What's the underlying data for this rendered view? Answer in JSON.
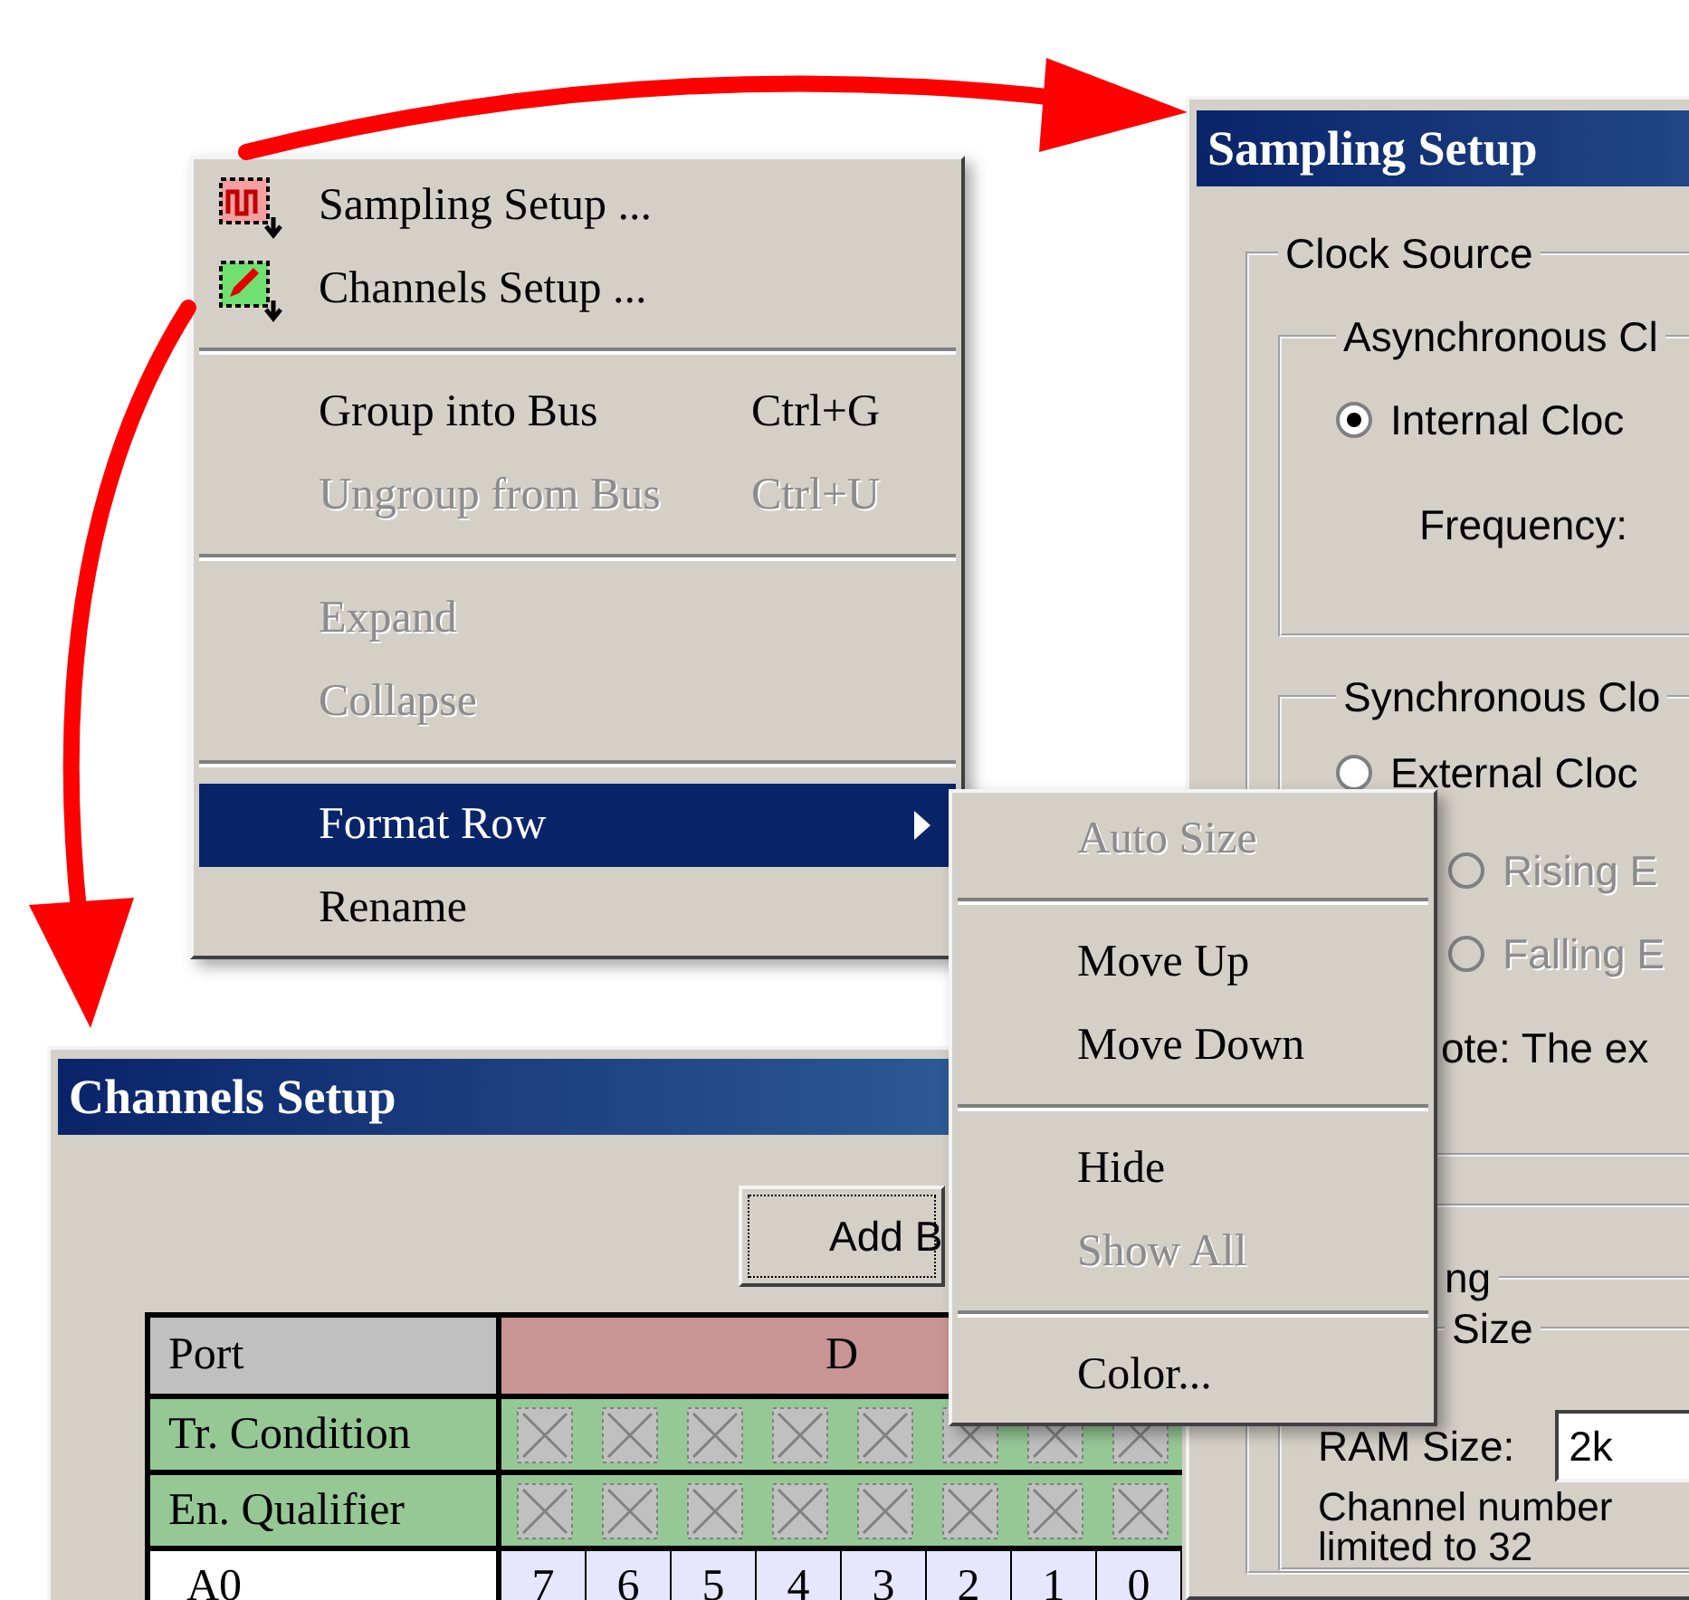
{
  "context_menu": {
    "groups": [
      [
        {
          "kind": "waveform",
          "label": "Sampling Setup ...",
          "disabled": false,
          "selected": false,
          "has_submenu": false
        },
        {
          "kind": "channels",
          "label": "Channels Setup ...",
          "disabled": false,
          "selected": false,
          "has_submenu": false
        }
      ],
      [
        {
          "kind": "plain",
          "label": "Group into Bus",
          "shortcut": "Ctrl+G",
          "disabled": false,
          "selected": false,
          "has_submenu": false
        },
        {
          "kind": "plain",
          "label": "Ungroup from Bus",
          "shortcut": "Ctrl+U",
          "disabled": true,
          "selected": false,
          "has_submenu": false
        }
      ],
      [
        {
          "kind": "plain",
          "label": "Expand",
          "disabled": true,
          "selected": false,
          "has_submenu": false
        },
        {
          "kind": "plain",
          "label": "Collapse",
          "disabled": true,
          "selected": false,
          "has_submenu": false
        }
      ],
      [
        {
          "kind": "plain",
          "label": "Format Row",
          "disabled": false,
          "selected": true,
          "has_submenu": true
        },
        {
          "kind": "plain",
          "label": "Rename",
          "disabled": false,
          "selected": false,
          "has_submenu": false
        }
      ]
    ]
  },
  "submenu": {
    "groups": [
      [
        {
          "label": "Auto Size",
          "disabled": true,
          "selected": false,
          "has_submenu": false
        }
      ],
      [
        {
          "label": "Move Up",
          "disabled": false,
          "selected": false,
          "has_submenu": false
        },
        {
          "label": "Move Down",
          "disabled": false,
          "selected": false,
          "has_submenu": false
        }
      ],
      [
        {
          "label": "Hide",
          "disabled": false,
          "selected": false,
          "has_submenu": false
        },
        {
          "label": "Show All",
          "disabled": true,
          "selected": false,
          "has_submenu": false
        }
      ],
      [
        {
          "label": "Color...",
          "disabled": false,
          "selected": false,
          "has_submenu": false
        }
      ]
    ]
  },
  "sampling_setup": {
    "title": "Sampling Setup",
    "clock_source": {
      "legend": "Clock Source",
      "async": {
        "legend": "Asynchronous Cl",
        "radio": {
          "label": "Internal Cloc",
          "selected": true,
          "disabled": false
        },
        "frequency_label": "Frequency:"
      },
      "sync": {
        "legend": "Synchronous Clo",
        "radios": [
          {
            "label": "External Cloc",
            "selected": false,
            "disabled": false
          },
          {
            "label": "Rising E",
            "selected": false,
            "disabled": true
          },
          {
            "label": "Falling E",
            "selected": false,
            "disabled": true
          }
        ],
        "note": "ote: The ex"
      }
    },
    "group_legend": "ng",
    "ram": {
      "legend": "Size",
      "label": "RAM Size:",
      "value": "2k",
      "note": "Channel number",
      "note_2": "limited to 32"
    }
  },
  "channels_setup": {
    "title": "Channels Setup",
    "button": "Add B",
    "table": {
      "port_header": "Port",
      "port_name": "D",
      "condition_rows": [
        "Tr. Condition",
        "En. Qualifier"
      ],
      "channel_row": {
        "label": "A0",
        "bits": [
          "7",
          "6",
          "5",
          "4",
          "3",
          "2",
          "1",
          "0"
        ]
      }
    }
  }
}
